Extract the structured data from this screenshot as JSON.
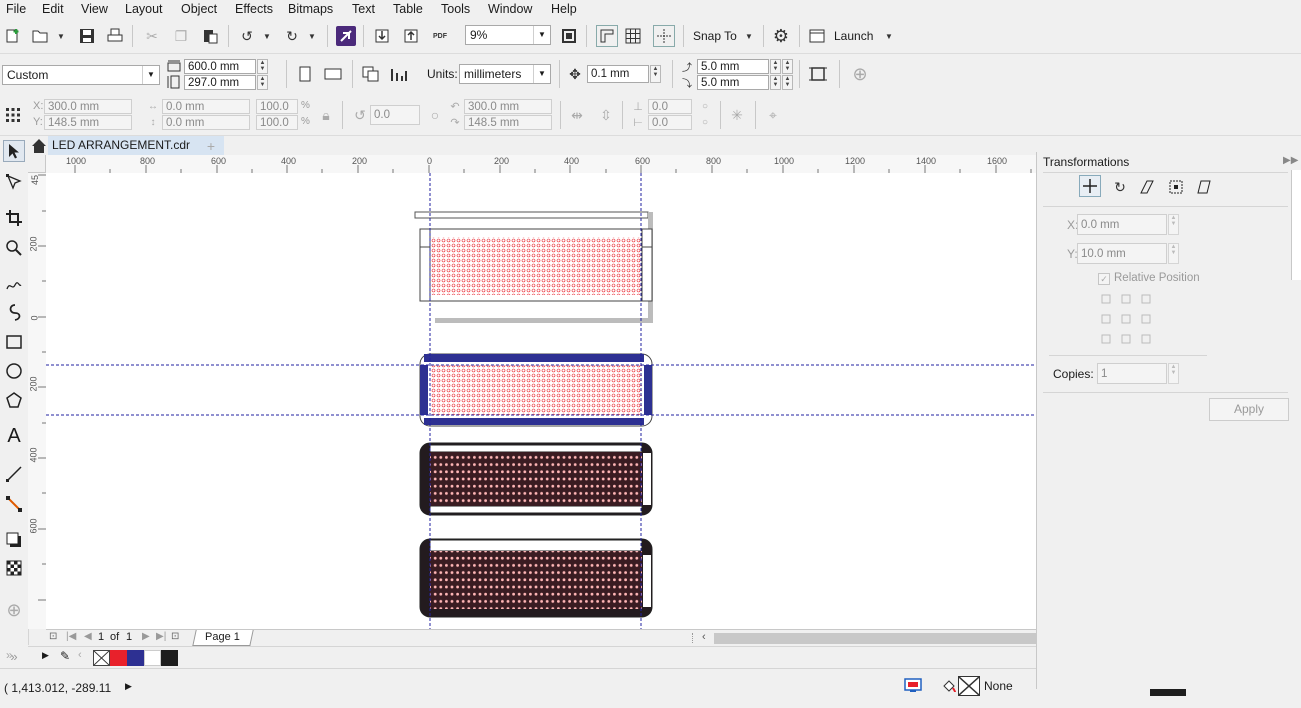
{
  "menu": [
    "File",
    "Edit",
    "View",
    "Layout",
    "Object",
    "Effects",
    "Bitmaps",
    "Text",
    "Table",
    "Tools",
    "Window",
    "Help"
  ],
  "standard_bar": {
    "zoom": "9%",
    "snap_to": "Snap To",
    "launch": "Launch"
  },
  "property_bar": {
    "page_preset": "Custom",
    "width": "600.0 mm",
    "height": "297.0 mm",
    "units_label": "Units:",
    "units": "millimeters",
    "nudge": "0.1 mm",
    "dup_x": "5.0 mm",
    "dup_y": "5.0 mm"
  },
  "object_bar": {
    "x_label": "X:",
    "x": "300.0 mm",
    "y_label": "Y:",
    "y": "148.5 mm",
    "w": "0.0 mm",
    "h": "0.0 mm",
    "sx": "100.0",
    "sy": "100.0",
    "pct": "%",
    "angle": "0.0",
    "cx": "300.0 mm",
    "cy": "148.5 mm",
    "skew_h": "0.0",
    "skew_v": "0.0"
  },
  "document": {
    "tab_title": "LED ARRANGEMENT.cdr",
    "page_current": "1",
    "page_of": "of",
    "page_total": "1",
    "page_tab": "Page 1"
  },
  "hruler_ticks": [
    "1000",
    "800",
    "600",
    "400",
    "200",
    "0",
    "200",
    "400",
    "600",
    "800",
    "1000",
    "1200",
    "1400",
    "1600"
  ],
  "vruler_ticks": [
    "45",
    "200",
    "0",
    "200",
    "400",
    "600"
  ],
  "docker": {
    "title": "Transformations",
    "x_label": "X:",
    "x": "0.0 mm",
    "y_label": "Y:",
    "y": "10.0 mm",
    "relative": "Relative Position",
    "copies_label": "Copies:",
    "copies": "1",
    "apply": "Apply"
  },
  "palette_colors": [
    "#e8212b",
    "#2d3092",
    "#ffffff",
    "#1e1e1e"
  ],
  "status": {
    "coords": "( 1,413.012, -289.11",
    "fill_none": "None"
  },
  "icons": [
    "new-icon",
    "open-icon",
    "save-icon",
    "print-icon",
    "undo-icon",
    "redo-icon",
    "import-icon",
    "export-icon",
    "pdf-icon",
    "settings-icon",
    "pick-tool-icon",
    "zoom-tool-icon",
    "rectangle-tool-icon",
    "ellipse-tool-icon",
    "polygon-tool-icon",
    "text-tool-icon"
  ]
}
